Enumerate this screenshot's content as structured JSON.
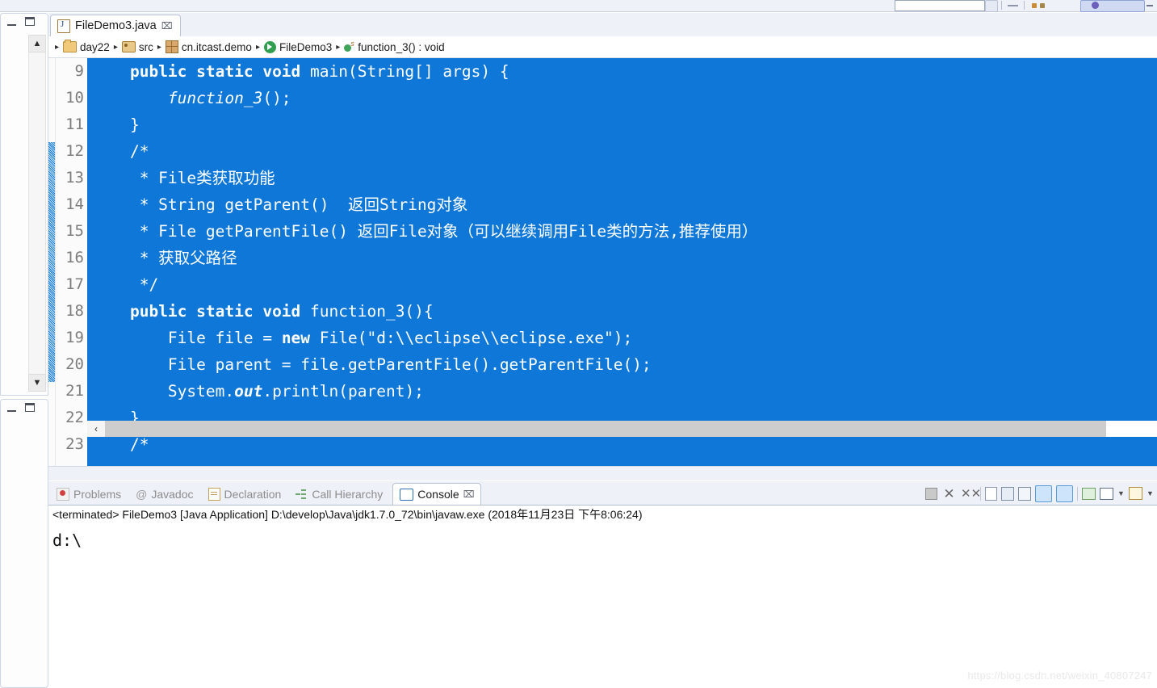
{
  "window": {
    "left_stub_top": {
      "minimize_label": "Minimize",
      "maximize_label": "Maximize"
    },
    "left_stub_bottom": {
      "minimize_label": "Minimize",
      "maximize_label": "Maximize"
    }
  },
  "editor": {
    "tab": {
      "label": "FileDemo3.java",
      "icon": "java-file-icon",
      "close_label": "⌧"
    },
    "breadcrumb": {
      "items": [
        {
          "label": "day22",
          "icon": "project-folder-icon"
        },
        {
          "label": "src",
          "icon": "source-folder-icon"
        },
        {
          "label": "cn.itcast.demo",
          "icon": "package-icon"
        },
        {
          "label": "FileDemo3",
          "icon": "class-icon"
        },
        {
          "label": "function_3() : void",
          "icon": "method-icon"
        }
      ],
      "separator": "▸"
    },
    "line_numbers": [
      "9",
      "10",
      "11",
      "12",
      "13",
      "14",
      "15",
      "16",
      "17",
      "18",
      "19",
      "20",
      "21",
      "22",
      "23"
    ],
    "selection_color": "#0f77d7",
    "code_lines": [
      {
        "n": "9",
        "segments": [
          {
            "t": "    ",
            "s": "plain"
          },
          {
            "t": "public static void ",
            "s": "kw"
          },
          {
            "t": "main(String[] args) {",
            "s": "plain"
          }
        ]
      },
      {
        "n": "10",
        "segments": [
          {
            "t": "        ",
            "s": "plain"
          },
          {
            "t": "function_3",
            "s": "it"
          },
          {
            "t": "();",
            "s": "plain"
          }
        ]
      },
      {
        "n": "11",
        "segments": [
          {
            "t": "    }",
            "s": "plain"
          }
        ]
      },
      {
        "n": "12",
        "segments": [
          {
            "t": "    /*",
            "s": "plain"
          }
        ]
      },
      {
        "n": "13",
        "segments": [
          {
            "t": "     * File类获取功能",
            "s": "plain"
          }
        ]
      },
      {
        "n": "14",
        "segments": [
          {
            "t": "     * String getParent()  返回String对象",
            "s": "plain"
          }
        ]
      },
      {
        "n": "15",
        "segments": [
          {
            "t": "     * File getParentFile() 返回File对象（可以继续调用File类的方法,推荐使用）",
            "s": "plain"
          }
        ]
      },
      {
        "n": "16",
        "segments": [
          {
            "t": "     * 获取父路径",
            "s": "plain"
          }
        ]
      },
      {
        "n": "17",
        "segments": [
          {
            "t": "     */",
            "s": "plain"
          }
        ]
      },
      {
        "n": "18",
        "segments": [
          {
            "t": "    ",
            "s": "plain"
          },
          {
            "t": "public static void ",
            "s": "kw"
          },
          {
            "t": "function_3(){",
            "s": "plain"
          }
        ]
      },
      {
        "n": "19",
        "segments": [
          {
            "t": "        File file = ",
            "s": "plain"
          },
          {
            "t": "new ",
            "s": "kw"
          },
          {
            "t": "File(\"d:\\\\eclipse\\\\eclipse.exe\");",
            "s": "plain"
          }
        ]
      },
      {
        "n": "20",
        "segments": [
          {
            "t": "        File parent = file.getParentFile().getParentFile();",
            "s": "plain"
          }
        ]
      },
      {
        "n": "21",
        "segments": [
          {
            "t": "        System.",
            "s": "plain"
          },
          {
            "t": "out",
            "s": "itb"
          },
          {
            "t": ".println(parent);",
            "s": "plain"
          }
        ]
      },
      {
        "n": "22",
        "segments": [
          {
            "t": "    }",
            "s": "plain"
          }
        ]
      },
      {
        "n": "23",
        "segments": [
          {
            "t": "    /*",
            "s": "plain"
          }
        ]
      }
    ],
    "hscroll": {
      "left_arrow": "‹"
    }
  },
  "console_part": {
    "tabs": [
      {
        "label": "Problems",
        "icon": "problems-icon",
        "active": false
      },
      {
        "label": "Javadoc",
        "icon": "javadoc-icon",
        "active": false
      },
      {
        "label": "Declaration",
        "icon": "declaration-icon",
        "active": false
      },
      {
        "label": "Call Hierarchy",
        "icon": "call-hierarchy-icon",
        "active": false
      },
      {
        "label": "Console",
        "icon": "console-icon",
        "active": true
      }
    ],
    "active_tab_close": "⌧",
    "toolbar_icons": [
      "terminate-icon",
      "remove-launch-icon",
      "remove-all-terminated-icon",
      "clear-console-icon",
      "scroll-lock-icon",
      "word-wrap-icon",
      "show-console-on-output-icon",
      "show-console-on-error-icon",
      "pin-console-icon",
      "display-selected-console-icon",
      "display-selected-console-menu-icon",
      "open-console-icon",
      "open-console-menu-icon"
    ],
    "status_line": "<terminated> FileDemo3 [Java Application] D:\\develop\\Java\\jdk1.7.0_72\\bin\\javaw.exe (2018年11月23日 下午8:06:24)",
    "output_lines": [
      "d:\\"
    ]
  },
  "watermark": "https://blog.csdn.net/weixin_40807247"
}
